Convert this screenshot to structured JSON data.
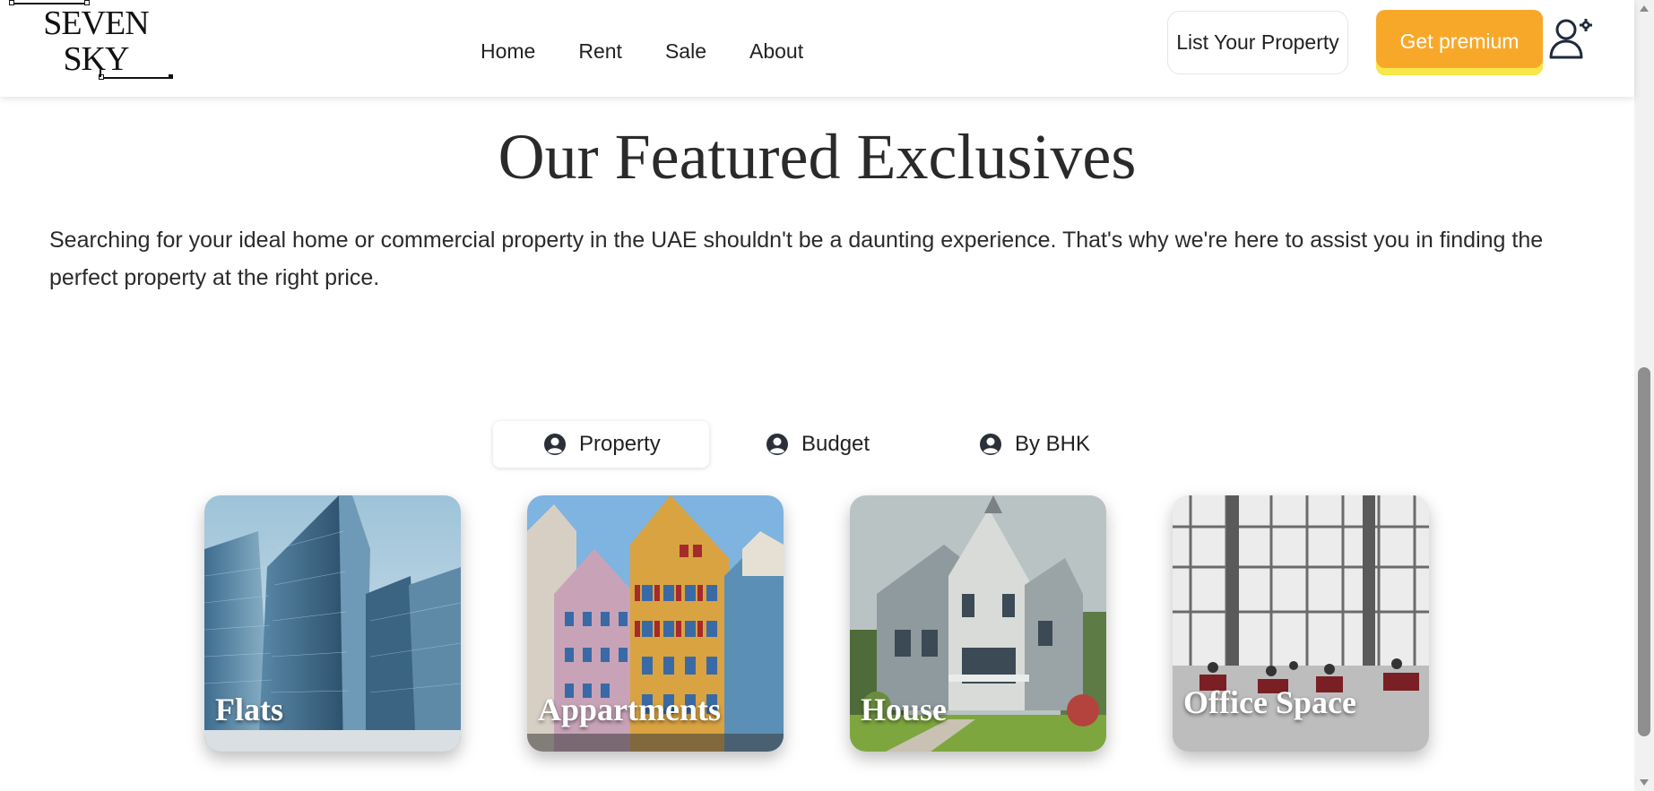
{
  "logo": {
    "line1": "SEVEN",
    "line2": "SKY"
  },
  "nav": {
    "items": [
      "Home",
      "Rent",
      "Sale",
      "About"
    ]
  },
  "header": {
    "list_property_label": "List Your Property",
    "premium_label": "Get premium",
    "premium_color": "#f8a829"
  },
  "main": {
    "title": "Our Featured Exclusives",
    "intro": "Searching for your ideal home or commercial property in the UAE shouldn't be a daunting experience. That's why we're here to assist you in finding the perfect property at the right price."
  },
  "tabs": [
    {
      "label": "Property",
      "icon": "user-circle-icon",
      "active": true
    },
    {
      "label": "Budget",
      "icon": "user-circle-icon",
      "active": false
    },
    {
      "label": "By BHK",
      "icon": "user-circle-icon",
      "active": false
    }
  ],
  "cards": [
    {
      "label": "Flats",
      "image": "glass-skyscrapers"
    },
    {
      "label": "Appartments",
      "image": "colorful-townhouses"
    },
    {
      "label": "House",
      "image": "victorian-house"
    },
    {
      "label": "Office Space",
      "image": "office-lounge"
    }
  ]
}
